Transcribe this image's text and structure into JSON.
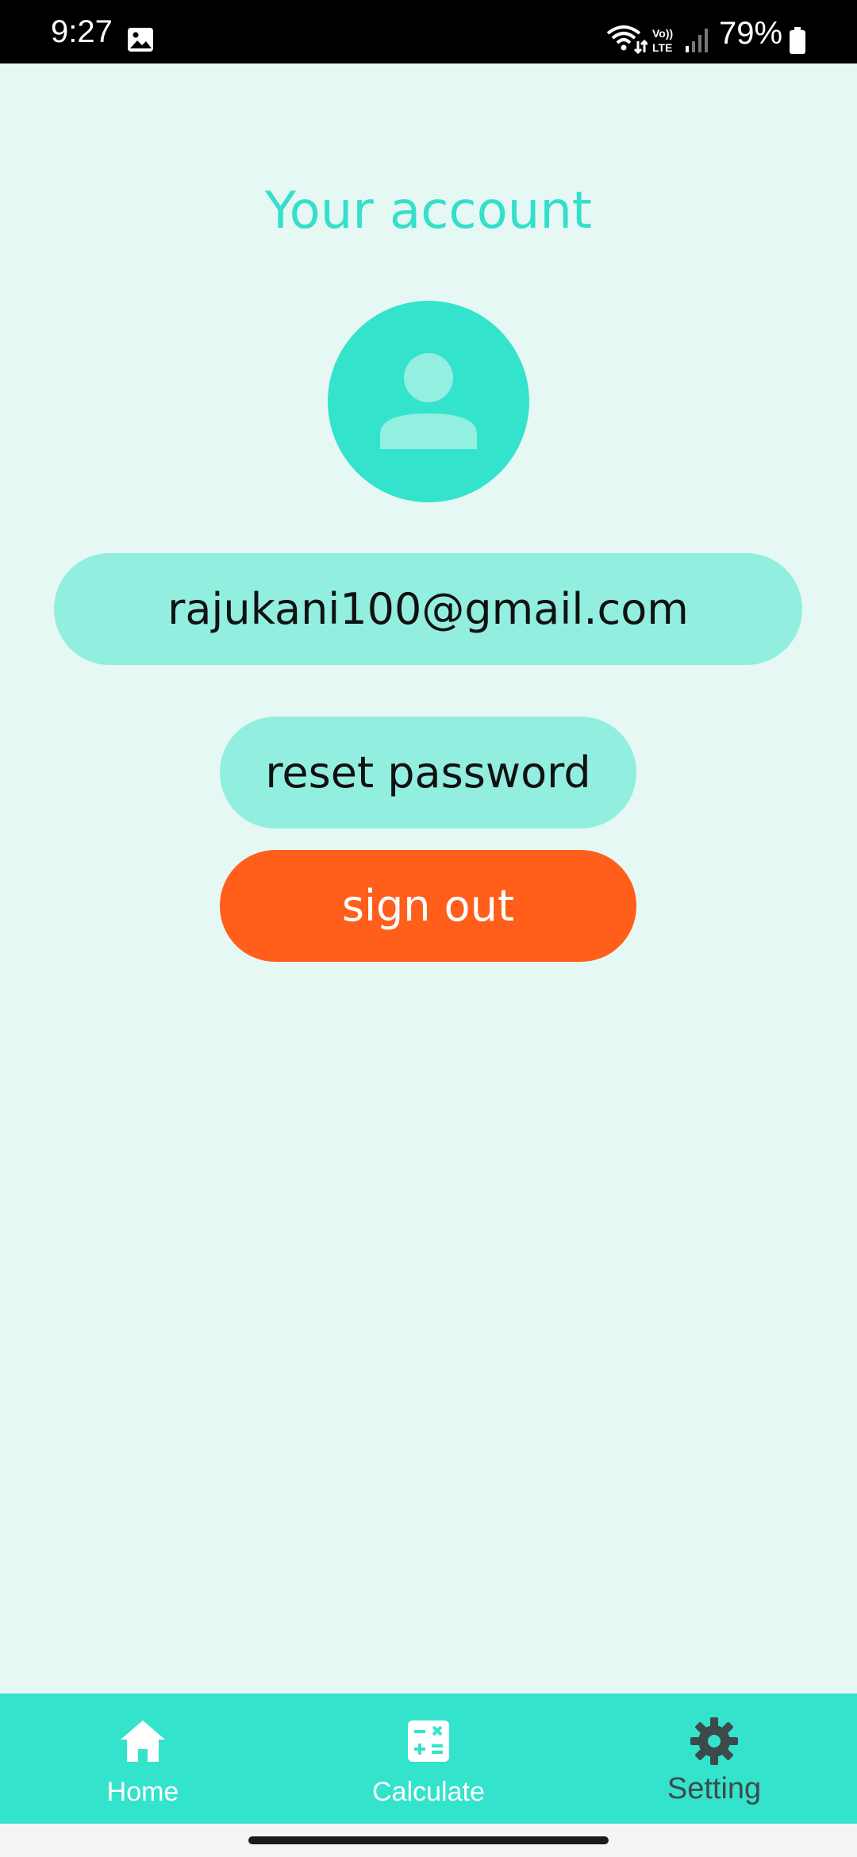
{
  "status_bar": {
    "time": "9:27",
    "battery": "79%",
    "icons": [
      "gallery-icon",
      "wifi-icon",
      "volte-icon",
      "signal-icon",
      "battery-icon"
    ]
  },
  "page": {
    "title": "Your account",
    "avatar_icon": "person-icon",
    "email": "rajukani100@gmail.com",
    "reset_label": "reset password",
    "signout_label": "sign out"
  },
  "nav": {
    "items": [
      {
        "label": "Home",
        "icon": "home-icon"
      },
      {
        "label": "Calculate",
        "icon": "calculator-icon"
      },
      {
        "label": "Setting",
        "icon": "gear-icon"
      }
    ],
    "active": "Setting"
  },
  "colors": {
    "background": "#e6f8f4",
    "accent": "#34e3cc",
    "pill": "#92efdf",
    "signout": "#ff5e1b",
    "title": "#35dfc9"
  }
}
